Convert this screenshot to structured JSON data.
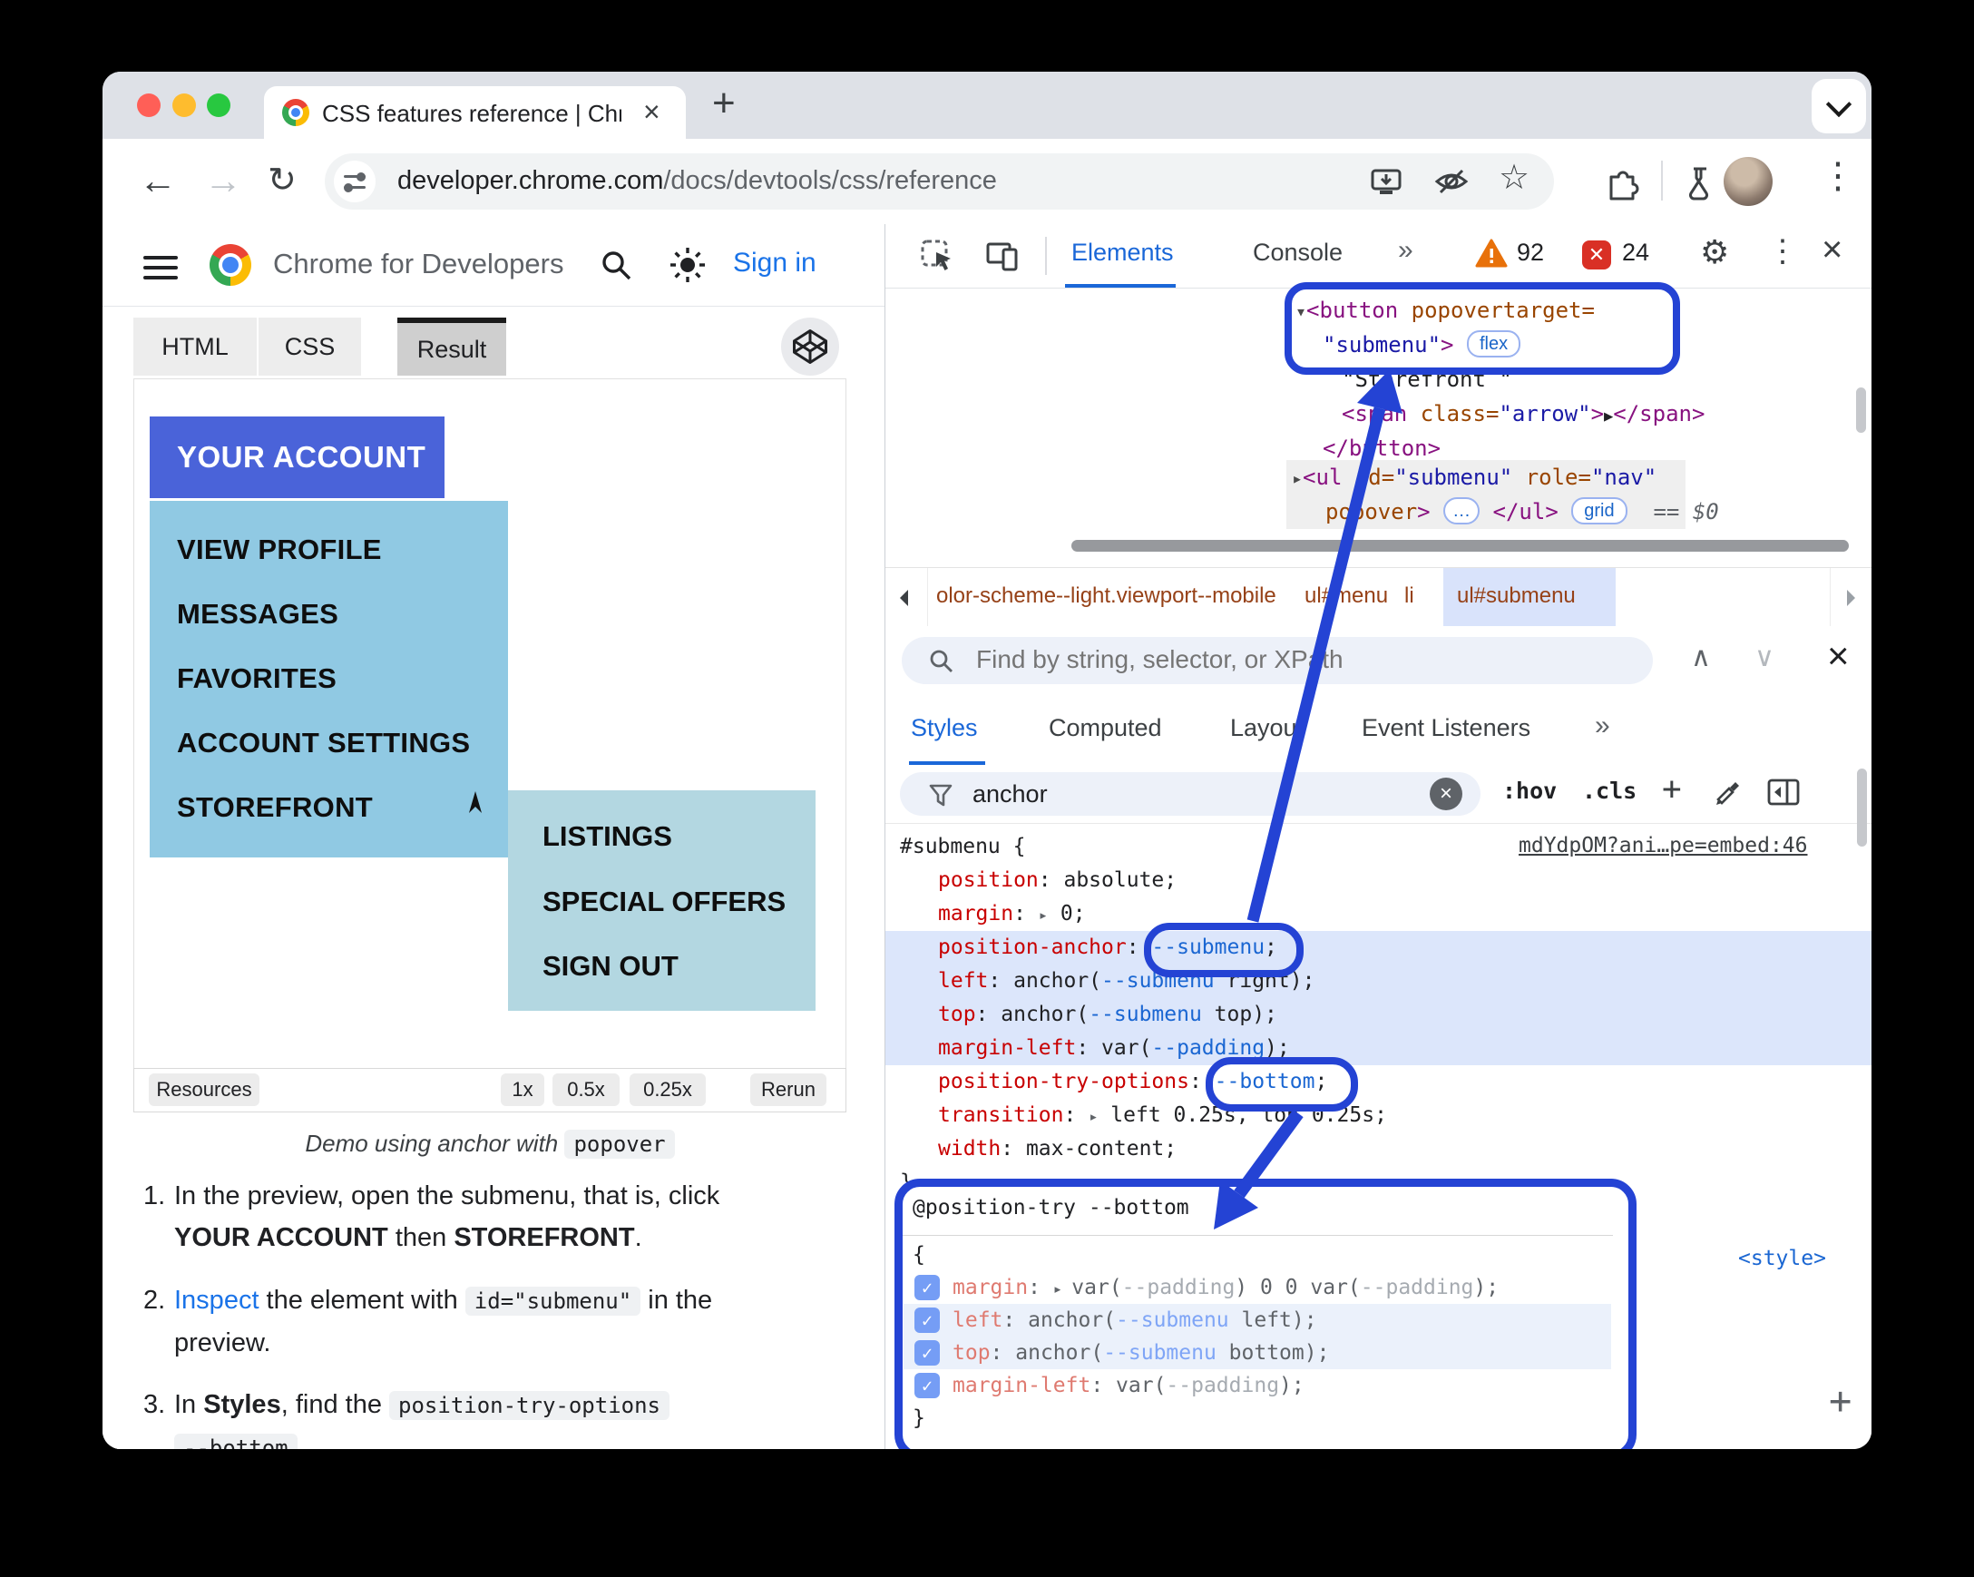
{
  "browser": {
    "tab_title": "CSS features reference  |  Chr",
    "close_glyph": "×",
    "new_tab_glyph": "+",
    "back_glyph": "←",
    "forward_glyph": "→",
    "reload_glyph": "↻",
    "url_host": "developer.chrome.com",
    "url_path": "/docs/devtools/css/reference",
    "kebab_glyph": "⋮"
  },
  "site": {
    "brand": "Chrome for Developers",
    "sign_in": "Sign in"
  },
  "embed": {
    "tab_html": "HTML",
    "tab_css": "CSS",
    "tab_result": "Result",
    "resources": "Resources",
    "speed_1x": "1x",
    "speed_05x": "0.5x",
    "speed_025x": "0.25x",
    "rerun": "Rerun"
  },
  "demo": {
    "account": "YOUR ACCOUNT",
    "items": [
      "VIEW PROFILE",
      "MESSAGES",
      "FAVORITES",
      "ACCOUNT SETTINGS",
      "STOREFRONT"
    ],
    "subitems": [
      "LISTINGS",
      "SPECIAL OFFERS",
      "SIGN OUT"
    ]
  },
  "caption": {
    "text": "Demo using anchor with ",
    "code": "popover"
  },
  "steps": {
    "n1": "1.",
    "s1a": "In the preview, open the submenu, that is, click",
    "s1b": "YOUR ACCOUNT",
    "s1c": " then ",
    "s1d": "STOREFRONT",
    "s1e": ".",
    "n2": "2.",
    "s2a": "Inspect",
    "s2b": " the element with ",
    "s2c": "id=\"submenu\"",
    "s2d": " in the",
    "s2e": "preview.",
    "n3": "3.",
    "s3a": "In ",
    "s3b": "Styles",
    "s3c": ", find the ",
    "s3d": "position-try-options",
    "s3e": "--bottom"
  },
  "devtools": {
    "tabs": {
      "elements": "Elements",
      "console": "Console",
      "more": "»",
      "warn_count": "92",
      "err_count": "24",
      "err_x": "✕",
      "close": "×",
      "gear": "⚙",
      "kebab": "⋮"
    },
    "dom": {
      "tri_open": "▾",
      "tri_closed": "▸",
      "btn_tag": "<button",
      "btn_attr": " popovertarget=",
      "btn_val": "\"submenu\"",
      "gt": ">",
      "flex": "flex",
      "text": "\"Storefront \"",
      "span_tag": "<span",
      "span_attr": " class=",
      "span_val": "\"arrow\"",
      "arrow_glyph": "▶",
      "span_close": "</span>",
      "btn_close": "</button>",
      "ul_tag": "<ul",
      "id_attr": " id=",
      "id_val": "\"submenu\"",
      "role_attr": " role=",
      "role_val": "\"nav\"",
      "popover": "popover",
      "dots": "…",
      "ul_close": "</ul>",
      "grid": "grid",
      "eq": "==",
      "dollar": "$0"
    },
    "crumbs": {
      "c1": "olor-scheme--light.viewport--mobile",
      "c2": "ul#menu",
      "c3": "li",
      "c4": "ul#submenu"
    },
    "find": {
      "placeholder": "Find by string, selector, or XPath",
      "up": "∧",
      "down": "∨",
      "close": "×"
    },
    "panes": {
      "styles": "Styles",
      "computed": "Computed",
      "layout": "Layout",
      "events": "Event Listeners",
      "more": "»"
    },
    "filter": {
      "value": "anchor",
      "hov": ":hov",
      "cls": ".cls",
      "plus": "+"
    },
    "rule": {
      "selector": "#submenu",
      "open": " {",
      "close": "}",
      "source": "mdYdpOM?ani…pe=embed:46",
      "p1n": "position",
      "colon": ": ",
      "p1v": "absolute;",
      "p2n": "margin",
      "marker": "▸",
      "p2v": " 0;",
      "p3n": "position-anchor",
      "p3v": "--submenu",
      "semi": ";",
      "p4n": "left",
      "p4a": "anchor(",
      "p4b": "--submenu",
      "p4c": " right);",
      "p5n": "top",
      "p5a": "anchor(",
      "p5b": "--submenu",
      "p5c": " top);",
      "p6n": "margin-left",
      "p6a": "var(",
      "p6b": "--padding",
      "p6c": ");",
      "p7n": "position-try-options",
      "p7v": "--bottom",
      "p8n": "transition",
      "p8v": " left 0.25s, top 0.25s;",
      "p9n": "width",
      "p9v": "max-content;"
    },
    "atrule": {
      "header": "@position-try --bottom",
      "open": "{",
      "close": "}",
      "check": "✓",
      "r1n": "margin",
      "colon": ": ",
      "marker": "▸ ",
      "r1a": "var(",
      "r1b": "--padding",
      "r1c": ") 0 0 var(",
      "r1d": "--padding",
      "r1e": ");",
      "r2n": "left",
      "r2a": "anchor(",
      "r2b": "--submenu",
      "r2c": " left);",
      "r3n": "top",
      "r3a": "anchor(",
      "r3b": "--submenu",
      "r3c": " bottom);",
      "r4n": "margin-left",
      "r4a": "var(",
      "r4b": "--padding",
      "r4c": ");",
      "style_link": "<style>",
      "add": "+"
    }
  }
}
